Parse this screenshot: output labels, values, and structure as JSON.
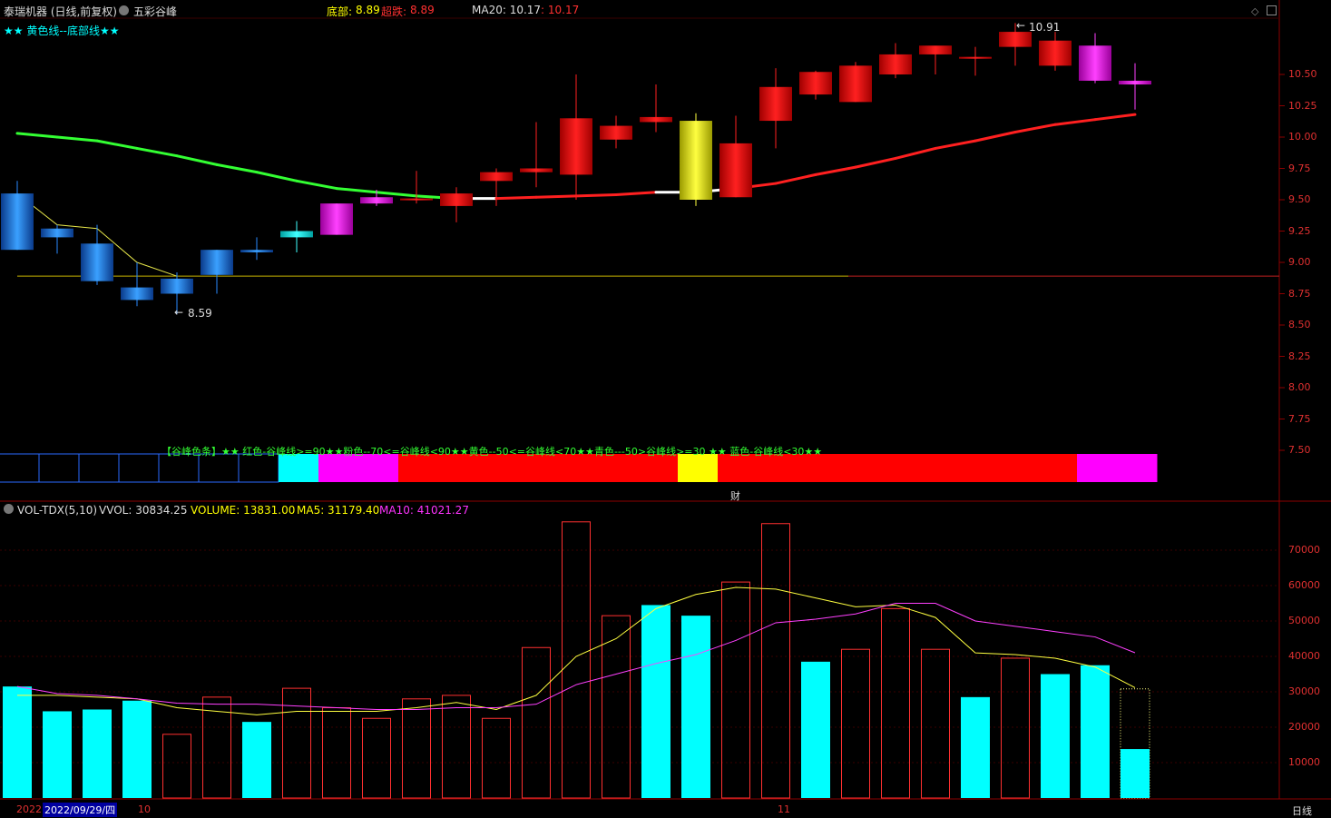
{
  "header": {
    "stock": "泰瑞机器 (日线,前复权)",
    "indicator": "五彩谷峰",
    "bottom_label": "底部:",
    "bottom_value": "8.89",
    "oversold_label": "超跌:",
    "oversold_value": "8.89",
    "ma_label": "MA20: 10.17",
    "ma_value": ": 10.17"
  },
  "legend": {
    "stars_line": "★★ 黄色线--底部线★★",
    "band_text": "【谷峰色条】★★ 红色-谷峰线>=90★★粉色--70<=谷峰线<90★★黄色--50<=谷峰线<70★★青色---50>谷峰线>=30 ★★ 蓝色-谷峰线<30★★"
  },
  "annotations": {
    "high": "10.91",
    "low": "8.59",
    "cai": "财"
  },
  "price_axis": [
    "10.50",
    "10.25",
    "10.00",
    "9.75",
    "9.50",
    "9.25",
    "9.00",
    "8.75",
    "8.50",
    "8.25",
    "8.00",
    "7.75",
    "7.50"
  ],
  "vol_header": {
    "name": "VOL-TDX(5,10)",
    "vvol": "VVOL: 30834.25",
    "volume": "VOLUME: 13831.00",
    "ma5": "MA5: 31179.40",
    "ma10": "MA10: 41021.27"
  },
  "vol_axis": [
    "70000",
    "60000",
    "50000",
    "40000",
    "30000",
    "20000",
    "10000"
  ],
  "bottom_bar": {
    "year": "2022",
    "date": "2022/09/29/四",
    "m10": "10",
    "m11": "11",
    "period": "日线"
  },
  "colors": {
    "up": "#ff0000",
    "down_cyan": "#00ffff",
    "magenta": "#ff00ff",
    "yellow": "#ffff00",
    "green_line": "#33ff33",
    "grid_red": "#8b0000"
  },
  "chart_data": [
    {
      "type": "candlestick",
      "title": "五彩谷峰",
      "ylim": [
        7.25,
        11.0
      ],
      "candles": [
        {
          "o": 9.55,
          "h": 9.65,
          "l": 9.1,
          "c": 9.1,
          "color": "blue"
        },
        {
          "o": 9.27,
          "h": 9.3,
          "l": 9.07,
          "c": 9.2,
          "color": "blue"
        },
        {
          "o": 9.15,
          "h": 9.3,
          "l": 8.82,
          "c": 8.85,
          "color": "blue"
        },
        {
          "o": 8.8,
          "h": 9.0,
          "l": 8.65,
          "c": 8.7,
          "color": "blue"
        },
        {
          "o": 8.87,
          "h": 8.92,
          "l": 8.59,
          "c": 8.75,
          "color": "blue"
        },
        {
          "o": 9.1,
          "h": 9.1,
          "l": 8.75,
          "c": 8.9,
          "color": "blue"
        },
        {
          "o": 9.1,
          "h": 9.2,
          "l": 9.02,
          "c": 9.08,
          "color": "blue"
        },
        {
          "o": 9.2,
          "h": 9.33,
          "l": 9.08,
          "c": 9.25,
          "color": "cyan"
        },
        {
          "o": 9.47,
          "h": 9.47,
          "l": 9.22,
          "c": 9.22,
          "color": "magenta"
        },
        {
          "o": 9.52,
          "h": 9.58,
          "l": 9.45,
          "c": 9.47,
          "color": "magenta"
        },
        {
          "o": 9.51,
          "h": 9.73,
          "l": 9.47,
          "c": 9.51,
          "color": "red"
        },
        {
          "o": 9.45,
          "h": 9.6,
          "l": 9.32,
          "c": 9.55,
          "color": "red"
        },
        {
          "o": 9.65,
          "h": 9.75,
          "l": 9.45,
          "c": 9.72,
          "color": "red"
        },
        {
          "o": 9.72,
          "h": 10.12,
          "l": 9.6,
          "c": 9.75,
          "color": "red"
        },
        {
          "o": 9.7,
          "h": 10.5,
          "l": 9.5,
          "c": 10.15,
          "color": "red"
        },
        {
          "o": 9.98,
          "h": 10.17,
          "l": 9.91,
          "c": 10.09,
          "color": "red"
        },
        {
          "o": 10.12,
          "h": 10.42,
          "l": 10.04,
          "c": 10.16,
          "color": "red"
        },
        {
          "o": 9.5,
          "h": 10.19,
          "l": 9.45,
          "c": 10.13,
          "color": "yellow"
        },
        {
          "o": 9.52,
          "h": 10.17,
          "l": 9.52,
          "c": 9.95,
          "color": "red"
        },
        {
          "o": 10.13,
          "h": 10.55,
          "l": 9.91,
          "c": 10.4,
          "color": "red"
        },
        {
          "o": 10.34,
          "h": 10.53,
          "l": 10.3,
          "c": 10.52,
          "color": "red"
        },
        {
          "o": 10.28,
          "h": 10.6,
          "l": 10.28,
          "c": 10.57,
          "color": "red"
        },
        {
          "o": 10.5,
          "h": 10.75,
          "l": 10.47,
          "c": 10.66,
          "color": "red"
        },
        {
          "o": 10.66,
          "h": 10.72,
          "l": 10.5,
          "c": 10.73,
          "color": "red"
        },
        {
          "o": 10.64,
          "h": 10.72,
          "l": 10.49,
          "c": 10.64,
          "color": "red"
        },
        {
          "o": 10.72,
          "h": 10.91,
          "l": 10.57,
          "c": 10.84,
          "color": "red"
        },
        {
          "o": 10.57,
          "h": 10.84,
          "l": 10.53,
          "c": 10.77,
          "color": "red"
        },
        {
          "o": 10.45,
          "h": 10.83,
          "l": 10.43,
          "c": 10.73,
          "color": "magenta"
        },
        {
          "o": 10.42,
          "h": 10.59,
          "l": 10.22,
          "c": 10.45,
          "color": "magenta"
        }
      ],
      "bottom_line": 8.89,
      "thin_line": [
        9.55,
        9.3,
        9.27,
        9.0,
        8.89,
        8.89,
        8.89,
        8.89,
        8.89,
        8.89,
        8.89,
        8.89,
        8.89,
        8.89,
        8.89,
        8.89,
        8.89,
        8.89,
        8.89,
        8.89,
        8.89,
        8.89,
        8.89,
        8.89,
        8.89,
        8.89,
        8.89,
        8.89,
        8.89
      ],
      "ma20": [
        10.03,
        10.0,
        9.97,
        9.91,
        9.85,
        9.78,
        9.72,
        9.65,
        9.59,
        9.56,
        9.53,
        9.51,
        9.51,
        9.52,
        9.53,
        9.54,
        9.56,
        9.56,
        9.59,
        9.63,
        9.7,
        9.76,
        9.83,
        9.91,
        9.97,
        10.04,
        10.1,
        10.14,
        10.18
      ],
      "band_colors": [
        "blue",
        "blue",
        "blue",
        "blue",
        "blue",
        "blue",
        "blue",
        "cyan",
        "magenta",
        "magenta",
        "red",
        "red",
        "red",
        "red",
        "red",
        "red",
        "red",
        "yellow",
        "red",
        "red",
        "red",
        "red",
        "red",
        "red",
        "red",
        "red",
        "red",
        "magenta",
        "magenta"
      ]
    },
    {
      "type": "bar",
      "title": "VOL-TDX(5,10)",
      "ylim": [
        0,
        80000
      ],
      "values": [
        31500,
        24500,
        25000,
        27500,
        18000,
        28500,
        21500,
        31000,
        25500,
        22500,
        28000,
        29000,
        22500,
        42500,
        78000,
        51500,
        54500,
        51500,
        61000,
        77500,
        38500,
        42000,
        53500,
        42000,
        28500,
        39500,
        35000,
        37500,
        13831
      ],
      "filled": [
        true,
        true,
        true,
        true,
        false,
        false,
        true,
        false,
        false,
        false,
        false,
        false,
        false,
        false,
        false,
        false,
        true,
        true,
        false,
        false,
        true,
        false,
        false,
        false,
        true,
        false,
        true,
        true,
        true
      ],
      "ma5": [
        29000,
        29000,
        28500,
        28000,
        25500,
        24500,
        23500,
        24500,
        24500,
        24500,
        25500,
        27000,
        25000,
        29000,
        40000,
        45000,
        53500,
        57500,
        59500,
        59000,
        56500,
        54000,
        54500,
        51000,
        41000,
        40500,
        39500,
        37000,
        31179.4
      ],
      "ma10": [
        31500,
        29500,
        29000,
        28000,
        26800,
        26500,
        26500,
        26000,
        25500,
        25000,
        25000,
        25500,
        25500,
        26500,
        32000,
        35000,
        38000,
        40500,
        44500,
        49500,
        50500,
        52000,
        55000,
        55000,
        50000,
        48500,
        47000,
        45500,
        41021.27
      ]
    }
  ]
}
